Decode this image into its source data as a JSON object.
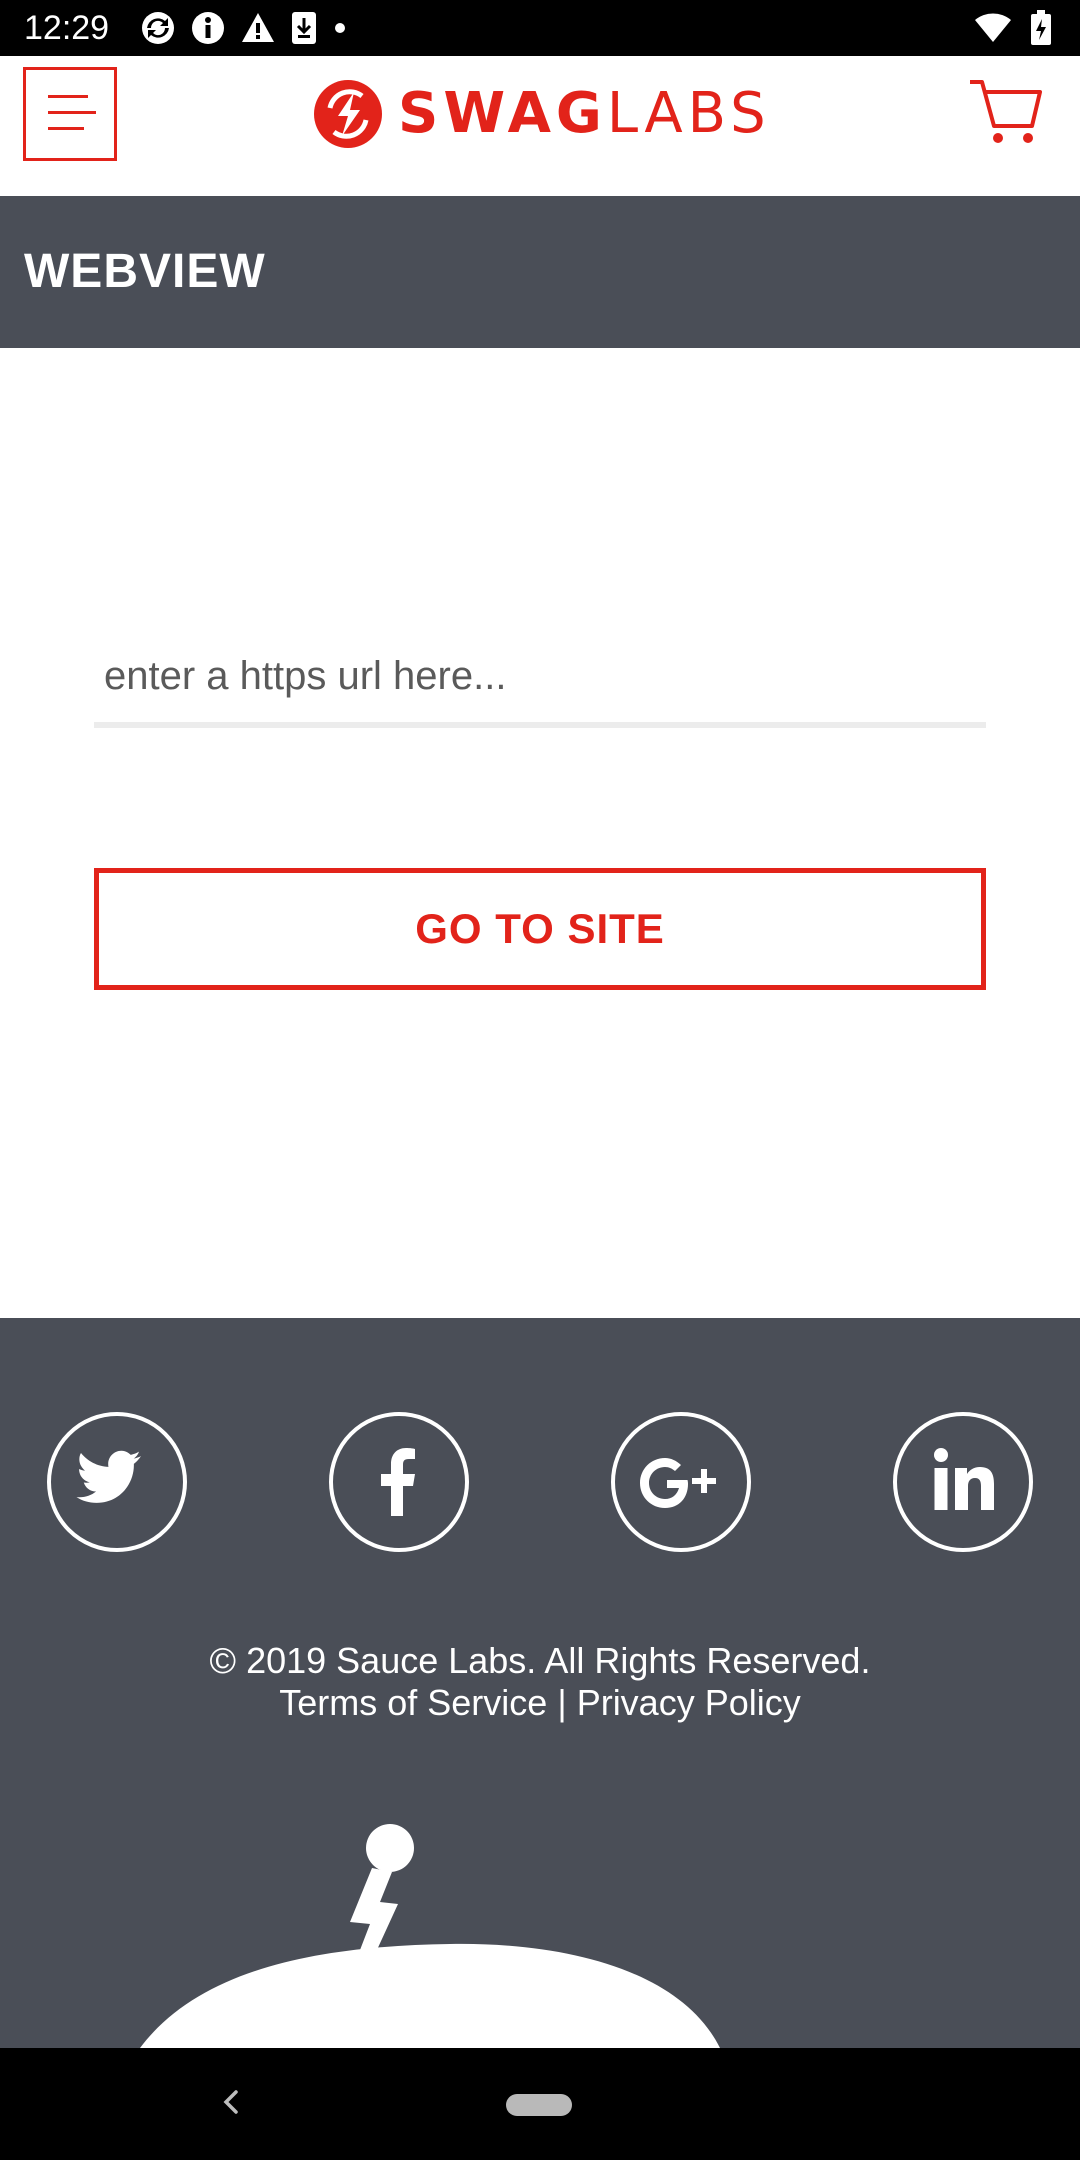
{
  "status_bar": {
    "time": "12:29",
    "icons": [
      "sync-icon",
      "info-icon",
      "warning-icon",
      "download-icon",
      "dot-icon",
      "wifi-icon",
      "battery-icon"
    ]
  },
  "header": {
    "logo": {
      "bold": "SWAG",
      "light": "LABS"
    },
    "icons": [
      "menu-icon",
      "cart-icon"
    ]
  },
  "page": {
    "title": "WEBVIEW"
  },
  "main": {
    "url_input": {
      "placeholder": "enter a https url here...",
      "value": ""
    },
    "go_button_label": "GO TO SITE"
  },
  "footer": {
    "social": [
      "twitter-icon",
      "facebook-icon",
      "google-plus-icon",
      "linkedin-icon"
    ],
    "copyright": "© 2019 Sauce Labs. All Rights Reserved.",
    "terms": "Terms of Service",
    "separator": " | ",
    "privacy": "Privacy Policy"
  },
  "colors": {
    "accent": "#e2231a",
    "dark": "#4a4e57",
    "white": "#ffffff"
  }
}
